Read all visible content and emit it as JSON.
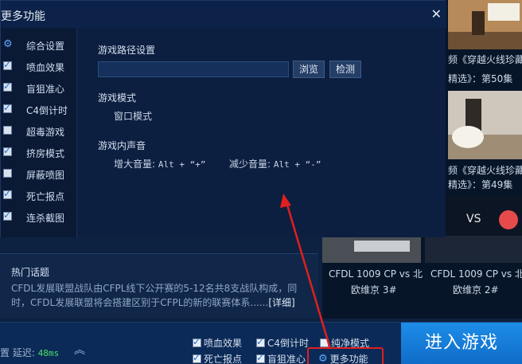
{
  "dialog": {
    "title": "更多功能",
    "close_icon": "✕",
    "sidebar": [
      {
        "label": "综合设置",
        "icon": "gear-icon",
        "checked": null
      },
      {
        "label": "喷血效果",
        "checked": true
      },
      {
        "label": "盲狙准心",
        "checked": true
      },
      {
        "label": "C4倒计时",
        "checked": true
      },
      {
        "label": "超毒游戏",
        "checked": false
      },
      {
        "label": "挤房模式",
        "checked": true
      },
      {
        "label": "屏蔽喷图",
        "checked": false
      },
      {
        "label": "死亡报点",
        "checked": true
      },
      {
        "label": "连杀截图",
        "checked": true
      }
    ],
    "path_section": {
      "title": "游戏路径设置",
      "value": "",
      "browse_label": "浏览",
      "detect_label": "检测"
    },
    "mode_section": {
      "title": "游戏模式",
      "value": "窗口模式"
    },
    "sound_section": {
      "title": "游戏内声音",
      "increase_label": "增大音量:",
      "increase_key": "Alt + “+”",
      "decrease_label": "减少音量:",
      "decrease_key": "Alt + “-”"
    }
  },
  "news": {
    "head": "热门话题",
    "body": "CFDL发展联盟战队由CFPL线下公开赛的5-12名共8支战队构成，同时，CFDL发展联盟将会搭建区别于CFPL的新的联赛体系......",
    "more": "[详细]"
  },
  "videos": [
    {
      "title_line1": "频《穿越火线珍藏",
      "title_line2": "精选》：第50集"
    },
    {
      "title_line1": "频《穿越火线珍藏",
      "title_line2": "精选》：第49集"
    },
    {
      "title_line1": "CFDL 1009 CP vs 北",
      "title_line2": "欧维京 3#"
    },
    {
      "title_line1": "CFDL 1009 CP vs 北",
      "title_line2": "欧维京 2#"
    }
  ],
  "bottom": {
    "delay_label": "置 延迟:",
    "delay_value": "48ms",
    "chevron_icon": "︽",
    "options": [
      {
        "label": "喷血效果",
        "checked": true
      },
      {
        "label": "C4倒计时",
        "checked": true
      },
      {
        "label": "纯净模式",
        "checked": false
      },
      {
        "label": "死亡报点",
        "checked": true
      },
      {
        "label": "盲狙准心",
        "checked": true
      }
    ],
    "more_label": "更多功能",
    "enter_label": "进入游戏"
  },
  "colors": {
    "accent": "#1d8de8",
    "highlight": "#e01f1f",
    "ok_green": "#4ee06a"
  }
}
